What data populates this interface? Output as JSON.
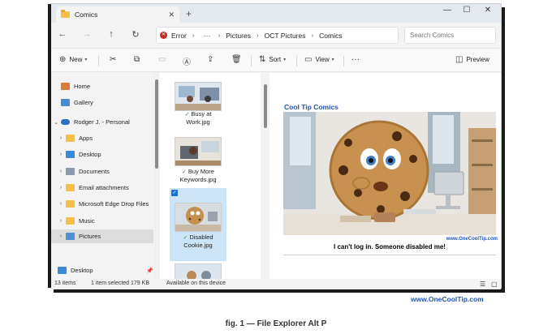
{
  "tab": {
    "title": "Comics",
    "close_glyph": "✕",
    "new_glyph": "+"
  },
  "window_controls": {
    "minimize": "—",
    "maximize": "☐",
    "close": "✕"
  },
  "address": {
    "error_label": "Error",
    "more": "···",
    "crumbs": [
      "Pictures",
      "OCT Pictures",
      "Comics"
    ],
    "separator": "›"
  },
  "search": {
    "placeholder": "Search Comics"
  },
  "command_bar": {
    "new_label": "New",
    "sort_label": "Sort",
    "view_label": "View",
    "more": "···",
    "preview_label": "Preview"
  },
  "nav": {
    "items": [
      {
        "label": "Home",
        "icon": "home-icon"
      },
      {
        "label": "Gallery",
        "icon": "gallery-icon"
      },
      {
        "label": "Rodger J. - Personal",
        "icon": "onedrive-icon"
      },
      {
        "label": "Apps",
        "icon": "folder-icon"
      },
      {
        "label": "Desktop",
        "icon": "desktop-icon"
      },
      {
        "label": "Documents",
        "icon": "documents-icon"
      },
      {
        "label": "Email attachments",
        "icon": "folder-icon"
      },
      {
        "label": "Microsoft Edge Drop Files",
        "icon": "folder-icon"
      },
      {
        "label": "Music",
        "icon": "folder-icon"
      },
      {
        "label": "Pictures",
        "icon": "pictures-icon"
      }
    ],
    "pinned": {
      "label": "Desktop",
      "icon": "desktop-icon"
    }
  },
  "files": [
    {
      "name_line1": "",
      "name_line2": ""
    },
    {
      "name_line1": "Busy at",
      "name_line2": "Work.jpg"
    },
    {
      "name_line1": "Buy More",
      "name_line2": "Keywords.jpg"
    },
    {
      "name_line1": "Disabled",
      "name_line2": "Cookie.jpg"
    }
  ],
  "preview": {
    "brand": "Cool Tip Comics",
    "url": "www.OneCoolTip.com",
    "caption": "I can't log in.  Someone disabled me!"
  },
  "status": {
    "items_count": "13 items",
    "selection": "1 item selected  179 KB",
    "availability": "Available on this device"
  },
  "footer": {
    "brand": "www.OneCoolTip.com",
    "figure_caption": "fig. 1 — File Explorer Alt P"
  },
  "colors": {
    "accent": "#1f6fd1",
    "brand_blue": "#1f56b8",
    "folder": "#f5c04a"
  }
}
